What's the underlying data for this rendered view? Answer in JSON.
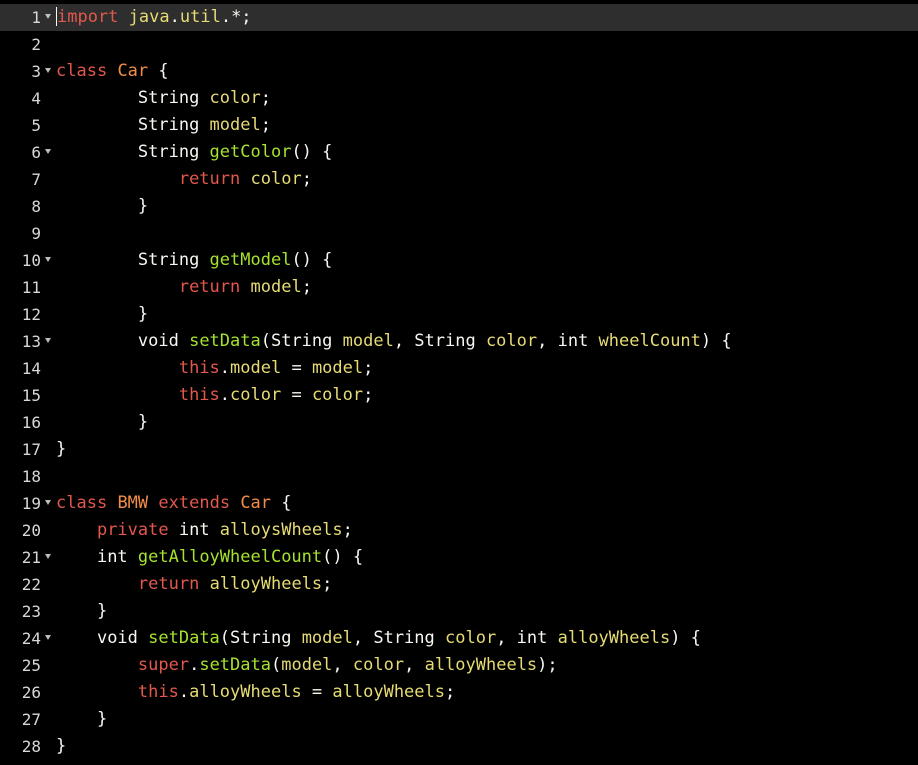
{
  "editor": {
    "colors": {
      "background": "#000000",
      "active_line": "#2e2e2e",
      "keyword": "#e2584d",
      "class_name": "#f08d49",
      "function": "#a6e22e",
      "identifier": "#e6db74",
      "plain": "#f8f8f2"
    },
    "fold_icon": "fold-triangle-icon",
    "active_line": 1,
    "lines": [
      {
        "n": "1",
        "fold": true,
        "indent": "",
        "tokens": [
          {
            "t": "import",
            "k": "kw2"
          },
          {
            "t": " ",
            "k": "pl"
          },
          {
            "t": "java",
            "k": "var"
          },
          {
            "t": ".",
            "k": "pl"
          },
          {
            "t": "util",
            "k": "var"
          },
          {
            "t": ".*;",
            "k": "pl"
          }
        ]
      },
      {
        "n": "2",
        "fold": false,
        "indent": "",
        "tokens": []
      },
      {
        "n": "3",
        "fold": true,
        "indent": "",
        "tokens": [
          {
            "t": "class",
            "k": "kw2"
          },
          {
            "t": " ",
            "k": "pl"
          },
          {
            "t": "Car",
            "k": "cls"
          },
          {
            "t": " {",
            "k": "pl"
          }
        ]
      },
      {
        "n": "4",
        "fold": false,
        "indent": "        ",
        "tokens": [
          {
            "t": "String ",
            "k": "pl"
          },
          {
            "t": "color",
            "k": "var"
          },
          {
            "t": ";",
            "k": "pl"
          }
        ]
      },
      {
        "n": "5",
        "fold": false,
        "indent": "        ",
        "tokens": [
          {
            "t": "String ",
            "k": "pl"
          },
          {
            "t": "model",
            "k": "var"
          },
          {
            "t": ";",
            "k": "pl"
          }
        ]
      },
      {
        "n": "6",
        "fold": true,
        "indent": "        ",
        "tokens": [
          {
            "t": "String ",
            "k": "pl"
          },
          {
            "t": "getColor",
            "k": "fn"
          },
          {
            "t": "() {",
            "k": "pl"
          }
        ]
      },
      {
        "n": "7",
        "fold": false,
        "indent": "            ",
        "tokens": [
          {
            "t": "return",
            "k": "kw2"
          },
          {
            "t": " ",
            "k": "pl"
          },
          {
            "t": "color",
            "k": "var"
          },
          {
            "t": ";",
            "k": "pl"
          }
        ]
      },
      {
        "n": "8",
        "fold": false,
        "indent": "        ",
        "tokens": [
          {
            "t": "}",
            "k": "pl"
          }
        ]
      },
      {
        "n": "9",
        "fold": false,
        "indent": "",
        "tokens": []
      },
      {
        "n": "10",
        "fold": true,
        "indent": "        ",
        "tokens": [
          {
            "t": "String ",
            "k": "pl"
          },
          {
            "t": "getModel",
            "k": "fn"
          },
          {
            "t": "() {",
            "k": "pl"
          }
        ]
      },
      {
        "n": "11",
        "fold": false,
        "indent": "            ",
        "tokens": [
          {
            "t": "return",
            "k": "kw2"
          },
          {
            "t": " ",
            "k": "pl"
          },
          {
            "t": "model",
            "k": "var"
          },
          {
            "t": ";",
            "k": "pl"
          }
        ]
      },
      {
        "n": "12",
        "fold": false,
        "indent": "        ",
        "tokens": [
          {
            "t": "}",
            "k": "pl"
          }
        ]
      },
      {
        "n": "13",
        "fold": true,
        "indent": "        ",
        "tokens": [
          {
            "t": "void ",
            "k": "pl"
          },
          {
            "t": "setData",
            "k": "fn"
          },
          {
            "t": "(String ",
            "k": "pl"
          },
          {
            "t": "model",
            "k": "var"
          },
          {
            "t": ", String ",
            "k": "pl"
          },
          {
            "t": "color",
            "k": "var"
          },
          {
            "t": ", int ",
            "k": "pl"
          },
          {
            "t": "wheelCount",
            "k": "var"
          },
          {
            "t": ") {",
            "k": "pl"
          }
        ]
      },
      {
        "n": "14",
        "fold": false,
        "indent": "            ",
        "tokens": [
          {
            "t": "this",
            "k": "kw2"
          },
          {
            "t": ".",
            "k": "pl"
          },
          {
            "t": "model",
            "k": "var"
          },
          {
            "t": " = ",
            "k": "pl"
          },
          {
            "t": "model",
            "k": "var"
          },
          {
            "t": ";",
            "k": "pl"
          }
        ]
      },
      {
        "n": "15",
        "fold": false,
        "indent": "            ",
        "tokens": [
          {
            "t": "this",
            "k": "kw2"
          },
          {
            "t": ".",
            "k": "pl"
          },
          {
            "t": "color",
            "k": "var"
          },
          {
            "t": " = ",
            "k": "pl"
          },
          {
            "t": "color",
            "k": "var"
          },
          {
            "t": ";",
            "k": "pl"
          }
        ]
      },
      {
        "n": "16",
        "fold": false,
        "indent": "        ",
        "tokens": [
          {
            "t": "}",
            "k": "pl"
          }
        ]
      },
      {
        "n": "17",
        "fold": false,
        "indent": "",
        "tokens": [
          {
            "t": "}",
            "k": "pl"
          }
        ]
      },
      {
        "n": "18",
        "fold": false,
        "indent": "",
        "tokens": []
      },
      {
        "n": "19",
        "fold": true,
        "indent": "",
        "tokens": [
          {
            "t": "class",
            "k": "kw2"
          },
          {
            "t": " ",
            "k": "pl"
          },
          {
            "t": "BMW",
            "k": "cls"
          },
          {
            "t": " ",
            "k": "pl"
          },
          {
            "t": "extends",
            "k": "kw2"
          },
          {
            "t": " ",
            "k": "pl"
          },
          {
            "t": "Car",
            "k": "cls"
          },
          {
            "t": " {",
            "k": "pl"
          }
        ]
      },
      {
        "n": "20",
        "fold": false,
        "indent": "    ",
        "tokens": [
          {
            "t": "private",
            "k": "kw2"
          },
          {
            "t": " int ",
            "k": "pl"
          },
          {
            "t": "alloysWheels",
            "k": "var"
          },
          {
            "t": ";",
            "k": "pl"
          }
        ]
      },
      {
        "n": "21",
        "fold": true,
        "indent": "    ",
        "tokens": [
          {
            "t": "int ",
            "k": "pl"
          },
          {
            "t": "getAlloyWheelCount",
            "k": "fn"
          },
          {
            "t": "() {",
            "k": "pl"
          }
        ]
      },
      {
        "n": "22",
        "fold": false,
        "indent": "        ",
        "tokens": [
          {
            "t": "return",
            "k": "kw2"
          },
          {
            "t": " ",
            "k": "pl"
          },
          {
            "t": "alloyWheels",
            "k": "var"
          },
          {
            "t": ";",
            "k": "pl"
          }
        ]
      },
      {
        "n": "23",
        "fold": false,
        "indent": "    ",
        "tokens": [
          {
            "t": "}",
            "k": "pl"
          }
        ]
      },
      {
        "n": "24",
        "fold": true,
        "indent": "    ",
        "tokens": [
          {
            "t": "void ",
            "k": "pl"
          },
          {
            "t": "setData",
            "k": "fn"
          },
          {
            "t": "(String ",
            "k": "pl"
          },
          {
            "t": "model",
            "k": "var"
          },
          {
            "t": ", String ",
            "k": "pl"
          },
          {
            "t": "color",
            "k": "var"
          },
          {
            "t": ", int ",
            "k": "pl"
          },
          {
            "t": "alloyWheels",
            "k": "var"
          },
          {
            "t": ") {",
            "k": "pl"
          }
        ]
      },
      {
        "n": "25",
        "fold": false,
        "indent": "        ",
        "tokens": [
          {
            "t": "super",
            "k": "kw2"
          },
          {
            "t": ".",
            "k": "pl"
          },
          {
            "t": "setData",
            "k": "fn"
          },
          {
            "t": "(",
            "k": "pl"
          },
          {
            "t": "model",
            "k": "var"
          },
          {
            "t": ", ",
            "k": "pl"
          },
          {
            "t": "color",
            "k": "var"
          },
          {
            "t": ", ",
            "k": "pl"
          },
          {
            "t": "alloyWheels",
            "k": "var"
          },
          {
            "t": ");",
            "k": "pl"
          }
        ]
      },
      {
        "n": "26",
        "fold": false,
        "indent": "        ",
        "tokens": [
          {
            "t": "this",
            "k": "kw2"
          },
          {
            "t": ".",
            "k": "pl"
          },
          {
            "t": "alloyWheels",
            "k": "var"
          },
          {
            "t": " = ",
            "k": "pl"
          },
          {
            "t": "alloyWheels",
            "k": "var"
          },
          {
            "t": ";",
            "k": "pl"
          }
        ]
      },
      {
        "n": "27",
        "fold": false,
        "indent": "    ",
        "tokens": [
          {
            "t": "}",
            "k": "pl"
          }
        ]
      },
      {
        "n": "28",
        "fold": false,
        "indent": "",
        "tokens": [
          {
            "t": "}",
            "k": "pl"
          }
        ]
      }
    ]
  }
}
